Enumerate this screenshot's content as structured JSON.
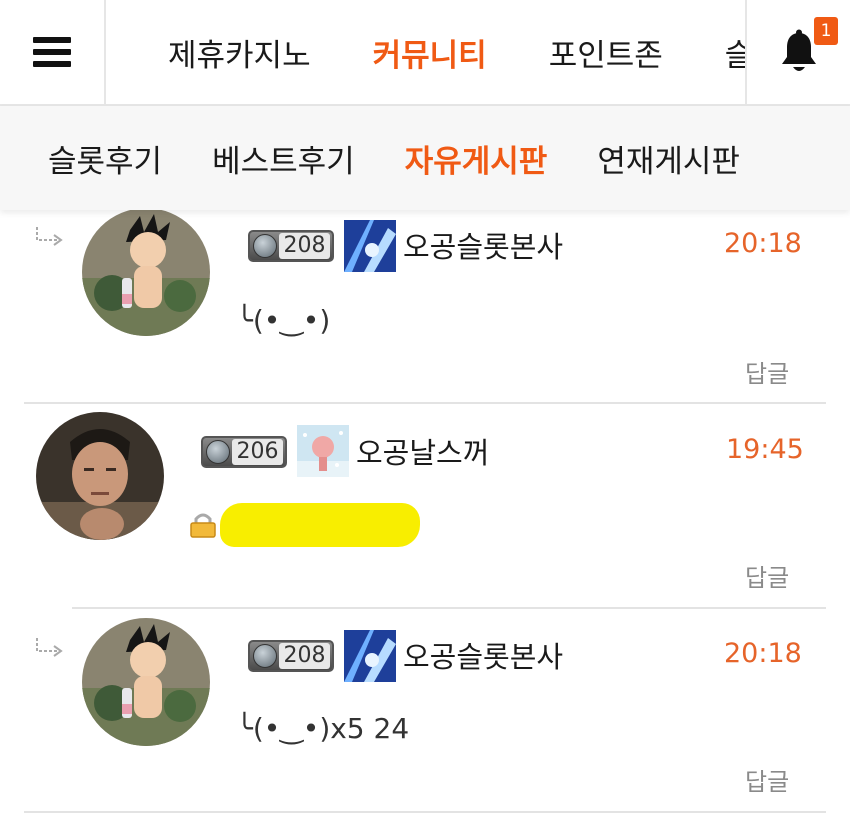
{
  "header": {
    "tabs": [
      {
        "label": "제휴카지노",
        "active": false
      },
      {
        "label": "커뮤니티",
        "active": true
      },
      {
        "label": "포인트존",
        "active": false
      },
      {
        "label": "슬",
        "active": false
      }
    ],
    "notification_count": "1"
  },
  "subnav": {
    "tabs": [
      {
        "label": "슬롯후기",
        "active": false
      },
      {
        "label": "베스트후기",
        "active": false
      },
      {
        "label": "자유게시판",
        "active": true
      },
      {
        "label": "연재게시판",
        "active": false
      }
    ]
  },
  "comments": [
    {
      "is_reply": true,
      "level": "208",
      "nickname": "오공슬롯본사",
      "time": "20:18",
      "text": "╰(•‿•)",
      "reply_label": "답글",
      "locked": false
    },
    {
      "is_reply": false,
      "level": "206",
      "nickname": "오공날스꺼",
      "time": "19:45",
      "text": "",
      "reply_label": "답글",
      "locked": true
    },
    {
      "is_reply": true,
      "level": "208",
      "nickname": "오공슬롯본사",
      "time": "20:18",
      "text": "╰(•‿•)x5 24",
      "reply_label": "답글",
      "locked": false
    }
  ],
  "colors": {
    "accent": "#f05a14",
    "time": "#e6642a",
    "highlight": "#f8ee00"
  }
}
